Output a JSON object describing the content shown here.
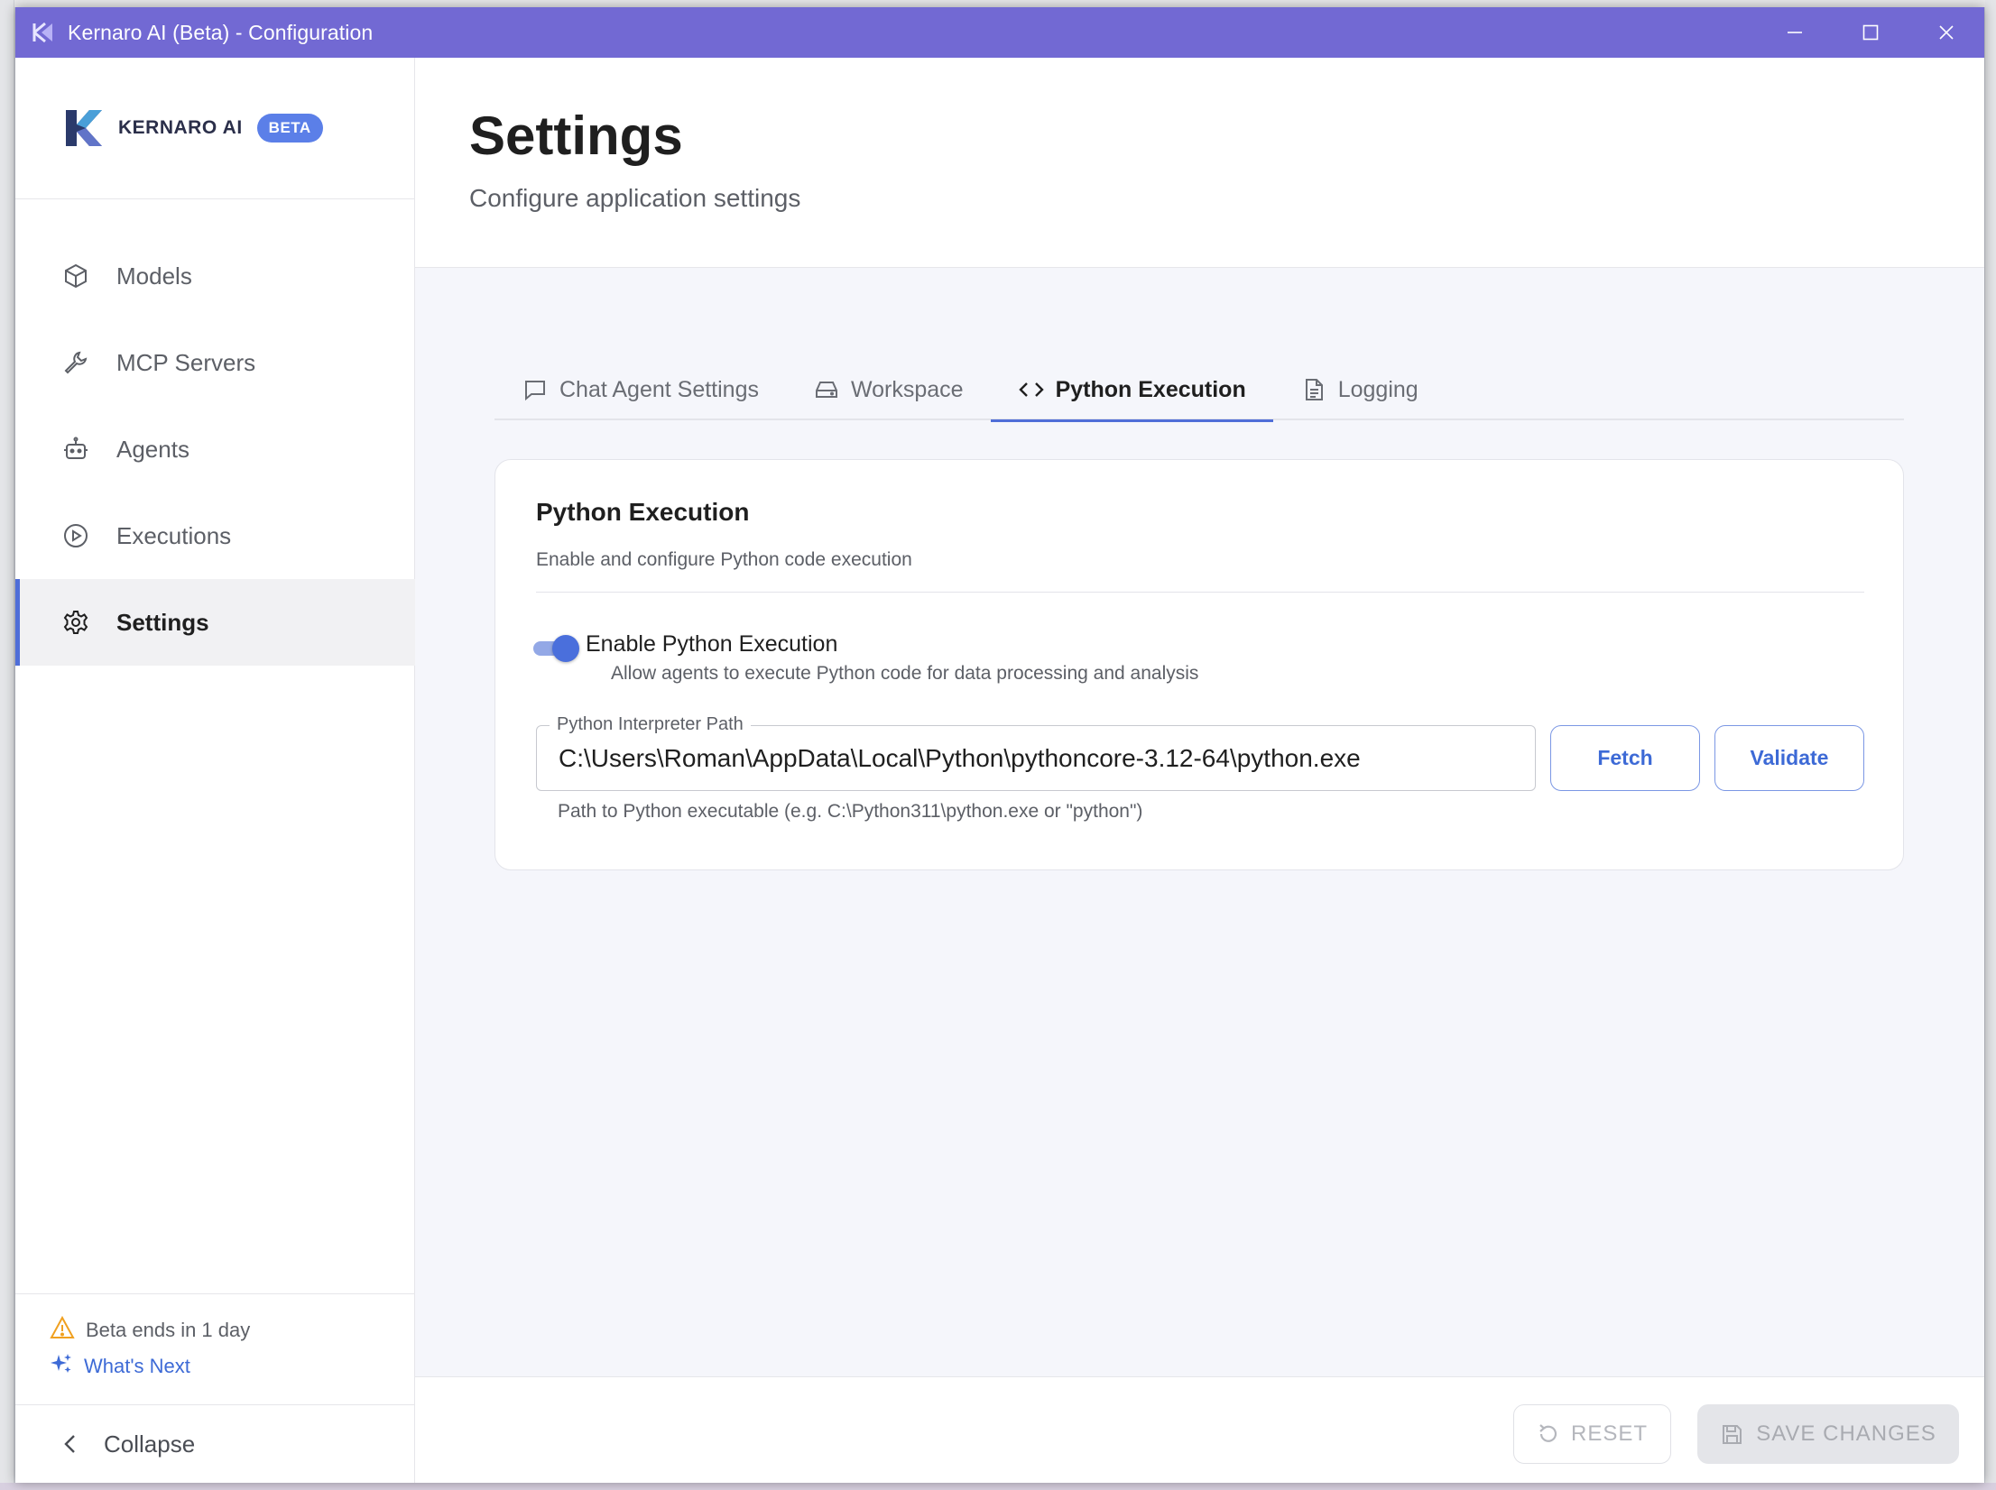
{
  "window": {
    "title": "Kernaro AI (Beta) - Configuration"
  },
  "brand": {
    "wordmark": "KERNARO",
    "ai": "AI",
    "badge": "BETA"
  },
  "sidebar": {
    "items": [
      {
        "label": "Models",
        "icon": "cube-icon"
      },
      {
        "label": "MCP Servers",
        "icon": "wrench-icon"
      },
      {
        "label": "Agents",
        "icon": "robot-icon"
      },
      {
        "label": "Executions",
        "icon": "play-circle-icon"
      },
      {
        "label": "Settings",
        "icon": "gear-icon",
        "active": true
      }
    ],
    "beta_notice": "Beta ends in 1 day",
    "whats_next": "What's Next",
    "collapse": "Collapse"
  },
  "header": {
    "title": "Settings",
    "subtitle": "Configure application settings"
  },
  "tabs": [
    {
      "label": "Chat Agent Settings",
      "icon": "chat-icon"
    },
    {
      "label": "Workspace",
      "icon": "drive-icon"
    },
    {
      "label": "Python Execution",
      "icon": "code-icon",
      "active": true
    },
    {
      "label": "Logging",
      "icon": "document-icon"
    }
  ],
  "card": {
    "title": "Python Execution",
    "description": "Enable and configure Python code execution",
    "toggle": {
      "label": "Enable Python Execution",
      "description": "Allow agents to execute Python code for data processing and analysis",
      "enabled": true
    },
    "interpreter": {
      "label": "Python Interpreter Path",
      "value": "C:\\Users\\Roman\\AppData\\Local\\Python\\pythoncore-3.12-64\\python.exe",
      "help": "Path to Python executable (e.g. C:\\Python311\\python.exe or \"python\")"
    },
    "fetch_label": "Fetch",
    "validate_label": "Validate"
  },
  "footer": {
    "reset_label": "RESET",
    "save_label": "SAVE CHANGES"
  },
  "colors": {
    "titlebar": "#7269d3",
    "accent": "#4f6ed8",
    "warning": "#f0a020"
  }
}
